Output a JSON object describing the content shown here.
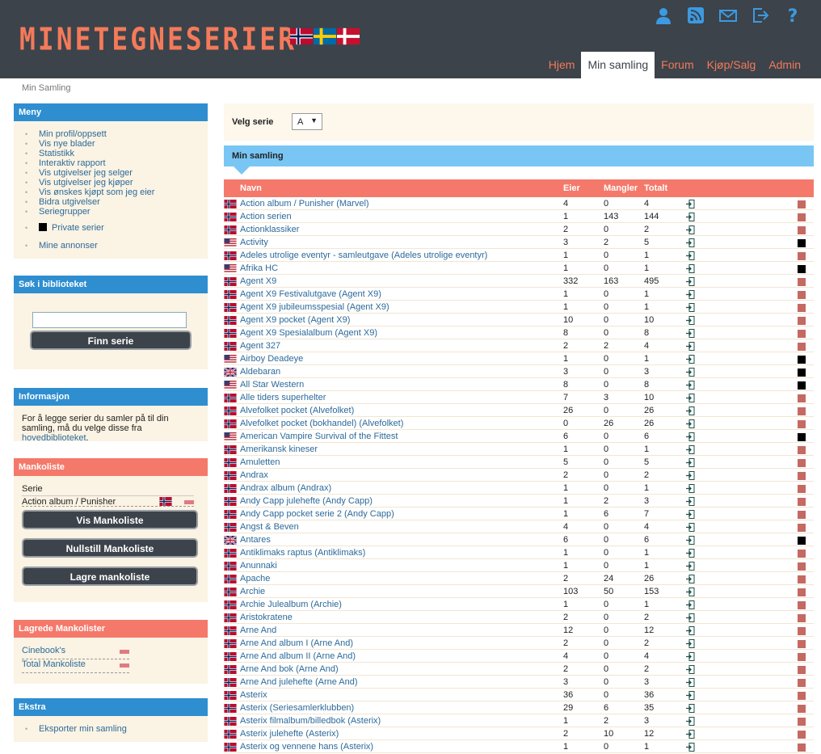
{
  "header": {
    "logo": "MINETEGNESERIER",
    "icons": [
      "user-icon",
      "rss-icon",
      "mail-icon",
      "logout-icon",
      "help-icon"
    ],
    "nav": [
      {
        "label": "Hjem",
        "active": false
      },
      {
        "label": "Min samling",
        "active": true
      },
      {
        "label": "Forum",
        "active": false
      },
      {
        "label": "Kjøp/Salg",
        "active": false
      },
      {
        "label": "Admin",
        "active": false
      }
    ]
  },
  "breadcrumb": "Min Samling",
  "sidebar": {
    "menu": {
      "title": "Meny",
      "items": [
        "Min profil/oppsett",
        "Vis nye blader",
        "Statistikk",
        "Interaktiv rapport",
        "Vis utgivelser jeg selger",
        "Vis utgivelser jeg kjøper",
        "Vis ønskes kjøpt som jeg eier",
        "Bidra utgivelser",
        "Seriegrupper"
      ],
      "private": "Private serier",
      "ads": "Mine annonser"
    },
    "search": {
      "title": "Søk i biblioteket",
      "value": "",
      "button": "Finn serie"
    },
    "info": {
      "title": "Informasjon",
      "text": "For å legge serier du samler på til din samling, må du velge disse fra ",
      "link": "hovedbiblioteket",
      "text_end": "."
    },
    "mankoliste": {
      "title": "Mankoliste",
      "col": "Serie",
      "item": "Action album / Punisher",
      "btn_show": "Vis Mankoliste",
      "btn_reset": "Nullstill Mankoliste",
      "btn_save": "Lagre mankoliste"
    },
    "saved": {
      "title": "Lagrede Mankolister",
      "items": [
        "Cinebook's",
        "Total Mankoliste"
      ]
    },
    "extra": {
      "title": "Ekstra",
      "item": "Eksporter min samling"
    }
  },
  "main": {
    "serie_label": "Velg serie",
    "serie_value": "A",
    "collection_title": "Min samling",
    "columns": {
      "name": "Navn",
      "owner": "Eier",
      "missing": "Mangler",
      "total": "Totalt"
    },
    "colors": {
      "flag_no": "#ba0c2f",
      "square_red": "#c46a63",
      "square_black": "#000000"
    }
  },
  "rows": [
    [
      "no",
      "Action album / Punisher (Marvel)",
      "4",
      "0",
      "4",
      "r"
    ],
    [
      "no",
      "Action serien",
      "1",
      "143",
      "144",
      "r"
    ],
    [
      "no",
      "Actionklassiker",
      "2",
      "0",
      "2",
      "r"
    ],
    [
      "us",
      "Activity",
      "3",
      "2",
      "5",
      "b"
    ],
    [
      "no",
      "Adeles utrolige eventyr - samleutgave (Adeles utrolige eventyr)",
      "1",
      "0",
      "1",
      "r"
    ],
    [
      "us",
      "Afrika HC",
      "1",
      "0",
      "1",
      "b"
    ],
    [
      "no",
      "Agent X9",
      "332",
      "163",
      "495",
      "r"
    ],
    [
      "no",
      "Agent X9 Festivalutgave (Agent X9)",
      "1",
      "0",
      "1",
      "r"
    ],
    [
      "no",
      "Agent X9 jubileumsspesial (Agent X9)",
      "1",
      "0",
      "1",
      "r"
    ],
    [
      "no",
      "Agent X9 pocket (Agent X9)",
      "10",
      "0",
      "10",
      "r"
    ],
    [
      "no",
      "Agent X9 Spesialalbum (Agent X9)",
      "8",
      "0",
      "8",
      "r"
    ],
    [
      "no",
      "Agent 327",
      "2",
      "2",
      "4",
      "r"
    ],
    [
      "us",
      "Airboy Deadeye",
      "1",
      "0",
      "1",
      "b"
    ],
    [
      "uk",
      "Aldebaran",
      "3",
      "0",
      "3",
      "b"
    ],
    [
      "us",
      "All Star Western",
      "8",
      "0",
      "8",
      "b"
    ],
    [
      "no",
      "Alle tiders superhelter",
      "7",
      "3",
      "10",
      "r"
    ],
    [
      "no",
      "Alvefolket pocket (Alvefolket)",
      "26",
      "0",
      "26",
      "r"
    ],
    [
      "no",
      "Alvefolket pocket (bokhandel) (Alvefolket)",
      "0",
      "26",
      "26",
      "r"
    ],
    [
      "us",
      "American Vampire Survival of the Fittest",
      "6",
      "0",
      "6",
      "b"
    ],
    [
      "no",
      "Amerikansk kineser",
      "1",
      "0",
      "1",
      "r"
    ],
    [
      "no",
      "Amuletten",
      "5",
      "0",
      "5",
      "r"
    ],
    [
      "no",
      "Andrax",
      "2",
      "0",
      "2",
      "r"
    ],
    [
      "no",
      "Andrax album (Andrax)",
      "1",
      "0",
      "1",
      "r"
    ],
    [
      "no",
      "Andy Capp julehefte (Andy Capp)",
      "1",
      "2",
      "3",
      "r"
    ],
    [
      "no",
      "Andy Capp pocket serie 2 (Andy Capp)",
      "1",
      "6",
      "7",
      "r"
    ],
    [
      "no",
      "Angst & Beven",
      "4",
      "0",
      "4",
      "r"
    ],
    [
      "uk",
      "Antares",
      "6",
      "0",
      "6",
      "b"
    ],
    [
      "no",
      "Antiklimaks raptus (Antiklimaks)",
      "1",
      "0",
      "1",
      "r"
    ],
    [
      "no",
      "Anunnaki",
      "1",
      "0",
      "1",
      "r"
    ],
    [
      "no",
      "Apache",
      "2",
      "24",
      "26",
      "r"
    ],
    [
      "no",
      "Archie",
      "103",
      "50",
      "153",
      "r"
    ],
    [
      "no",
      "Archie Julealbum (Archie)",
      "1",
      "0",
      "1",
      "r"
    ],
    [
      "no",
      "Aristokratene",
      "2",
      "0",
      "2",
      "r"
    ],
    [
      "no",
      "Arne And",
      "12",
      "0",
      "12",
      "r"
    ],
    [
      "no",
      "Arne And album I (Arne And)",
      "2",
      "0",
      "2",
      "r"
    ],
    [
      "no",
      "Arne And album II (Arne And)",
      "4",
      "0",
      "4",
      "r"
    ],
    [
      "no",
      "Arne And bok (Arne And)",
      "2",
      "0",
      "2",
      "r"
    ],
    [
      "no",
      "Arne And julehefte (Arne And)",
      "3",
      "0",
      "3",
      "r"
    ],
    [
      "no",
      "Asterix",
      "36",
      "0",
      "36",
      "r"
    ],
    [
      "no",
      "Asterix (Seriesamlerklubben)",
      "29",
      "6",
      "35",
      "r"
    ],
    [
      "no",
      "Asterix filmalbum/billedbok (Asterix)",
      "1",
      "2",
      "3",
      "r"
    ],
    [
      "no",
      "Asterix julehefte (Asterix)",
      "2",
      "10",
      "12",
      "r"
    ],
    [
      "no",
      "Asterix og vennene hans (Asterix)",
      "1",
      "0",
      "1",
      "r"
    ]
  ]
}
